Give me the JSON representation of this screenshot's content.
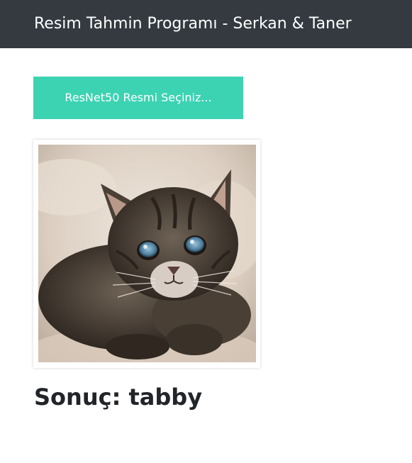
{
  "navbar": {
    "title": "Resim Tahmin Programı - Serkan & Taner"
  },
  "upload": {
    "button_label": "ResNet50 Resmi Seçiniz..."
  },
  "preview": {
    "image_subject": "kitten-photo"
  },
  "result": {
    "label": "Sonuç: tabby"
  },
  "colors": {
    "navbar_bg": "#343a40",
    "button_bg": "#3cd3b3",
    "text": "#212529"
  }
}
